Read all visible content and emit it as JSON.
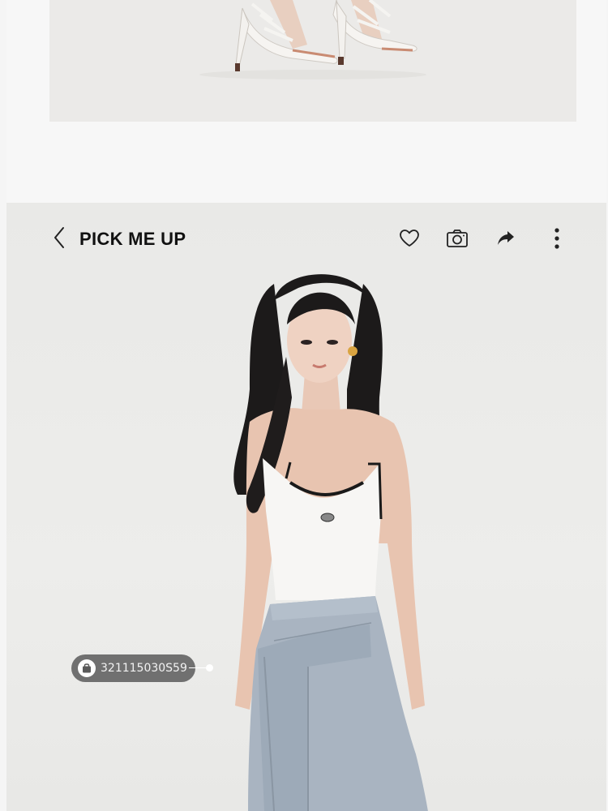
{
  "header": {
    "title": "PICK ME UP"
  },
  "icons": {
    "back": "chevron-left-icon",
    "favorite": "heart-icon",
    "camera": "camera-icon",
    "share": "share-icon",
    "more": "more-vertical-icon",
    "tag": "shopping-bag-icon"
  },
  "product_tag": {
    "code": "321115030S59"
  },
  "colors": {
    "card_background": "#e9e9e7",
    "tag_background": "#5a5a5a",
    "title": "#111111"
  }
}
